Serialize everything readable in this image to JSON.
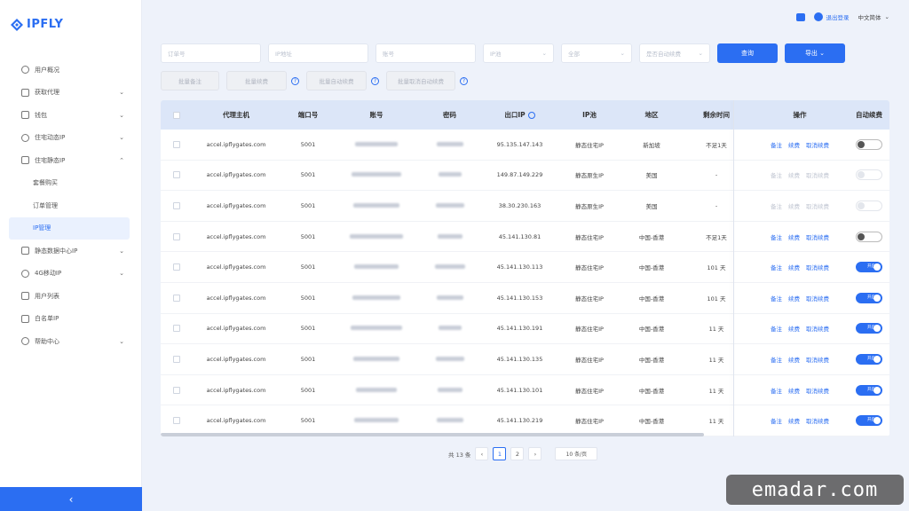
{
  "brand": {
    "name": "IPFLY",
    "color": "#2b6ef2"
  },
  "sidebar": {
    "items": [
      {
        "label": "用户概况",
        "icon": "user-icon",
        "chevron": ""
      },
      {
        "label": "获取代理",
        "icon": "proxy-icon",
        "chevron": "⌄"
      },
      {
        "label": "钱包",
        "icon": "wallet-icon",
        "chevron": "⌄"
      },
      {
        "label": "住宅动态IP",
        "icon": "globe-icon",
        "chevron": "⌄"
      },
      {
        "label": "住宅静态IP",
        "icon": "pin-icon",
        "chevron": "⌃"
      },
      {
        "label": "套餐购买",
        "icon": "",
        "chevron": "",
        "sub": true
      },
      {
        "label": "订单管理",
        "icon": "",
        "chevron": "",
        "sub": true
      },
      {
        "label": "IP管理",
        "icon": "",
        "chevron": "",
        "sub": true,
        "active": true
      },
      {
        "label": "静态数据中心IP",
        "icon": "server-icon",
        "chevron": "⌄"
      },
      {
        "label": "4G移动IP",
        "icon": "mobile-icon",
        "chevron": "⌄"
      },
      {
        "label": "用户列表",
        "icon": "users-icon",
        "chevron": ""
      },
      {
        "label": "白名单IP",
        "icon": "shield-icon",
        "chevron": ""
      },
      {
        "label": "帮助中心",
        "icon": "help-icon",
        "chevron": "⌄"
      }
    ],
    "collapse_glyph": "‹"
  },
  "topbar": {
    "user_label": "退出登录",
    "lang_label": "中文简体",
    "lang_chevron": "⌄"
  },
  "filters": {
    "order_no": "订单号",
    "ip_address": "IP地址",
    "account": "账号",
    "ip_pool": "IP池",
    "region": "全部",
    "auto_renew": "是否自动续费",
    "search_label": "查询",
    "export_label": "导出"
  },
  "actions": {
    "batch_note": "批量备注",
    "batch_renew": "批量续费",
    "batch_auto_renew": "批量自动续费",
    "batch_cancel_auto": "批量取消自动续费"
  },
  "table": {
    "headers": {
      "host": "代理主机",
      "port": "端口号",
      "account": "账号",
      "password": "密码",
      "ip": "出口IP",
      "pool": "IP池",
      "region": "地区",
      "remain": "剩余时间",
      "ops": "操作",
      "auto": "自动续费"
    },
    "op_labels": {
      "note": "备注",
      "renew": "续费",
      "cancel": "取消续费"
    },
    "toggle_on_label": "开启",
    "rows": [
      {
        "host": "accel.ipflygates.com",
        "port": "5001",
        "ip": "95.135.147.143",
        "pool": "静态住宅IP",
        "region": "新加坡",
        "remain": "不足1天",
        "ops_enabled": true,
        "auto": "off"
      },
      {
        "host": "accel.ipflygates.com",
        "port": "5001",
        "ip": "149.87.149.229",
        "pool": "静态原生IP",
        "region": "美国",
        "remain": "-",
        "ops_enabled": false,
        "auto": "disabled"
      },
      {
        "host": "accel.ipflygates.com",
        "port": "5001",
        "ip": "38.30.230.163",
        "pool": "静态原生IP",
        "region": "美国",
        "remain": "-",
        "ops_enabled": false,
        "auto": "disabled"
      },
      {
        "host": "accel.ipflygates.com",
        "port": "5001",
        "ip": "45.141.130.81",
        "pool": "静态住宅IP",
        "region": "中国-香港",
        "remain": "不足1天",
        "ops_enabled": true,
        "auto": "off"
      },
      {
        "host": "accel.ipflygates.com",
        "port": "5001",
        "ip": "45.141.130.113",
        "pool": "静态住宅IP",
        "region": "中国-香港",
        "remain": "101 天",
        "ops_enabled": true,
        "auto": "on"
      },
      {
        "host": "accel.ipflygates.com",
        "port": "5001",
        "ip": "45.141.130.153",
        "pool": "静态住宅IP",
        "region": "中国-香港",
        "remain": "101 天",
        "ops_enabled": true,
        "auto": "on"
      },
      {
        "host": "accel.ipflygates.com",
        "port": "5001",
        "ip": "45.141.130.191",
        "pool": "静态住宅IP",
        "region": "中国-香港",
        "remain": "11 天",
        "ops_enabled": true,
        "auto": "on"
      },
      {
        "host": "accel.ipflygates.com",
        "port": "5001",
        "ip": "45.141.130.135",
        "pool": "静态住宅IP",
        "region": "中国-香港",
        "remain": "11 天",
        "ops_enabled": true,
        "auto": "on"
      },
      {
        "host": "accel.ipflygates.com",
        "port": "5001",
        "ip": "45.141.130.101",
        "pool": "静态住宅IP",
        "region": "中国-香港",
        "remain": "11 天",
        "ops_enabled": true,
        "auto": "on"
      },
      {
        "host": "accel.ipflygates.com",
        "port": "5001",
        "ip": "45.141.130.219",
        "pool": "静态住宅IP",
        "region": "中国-香港",
        "remain": "11 天",
        "ops_enabled": true,
        "auto": "on"
      }
    ]
  },
  "pagination": {
    "total": "共 13 条",
    "prev": "‹",
    "pages": [
      "1",
      "2"
    ],
    "current": "1",
    "next": "›",
    "page_size": "10 条/页"
  },
  "watermark": "emadar.com"
}
